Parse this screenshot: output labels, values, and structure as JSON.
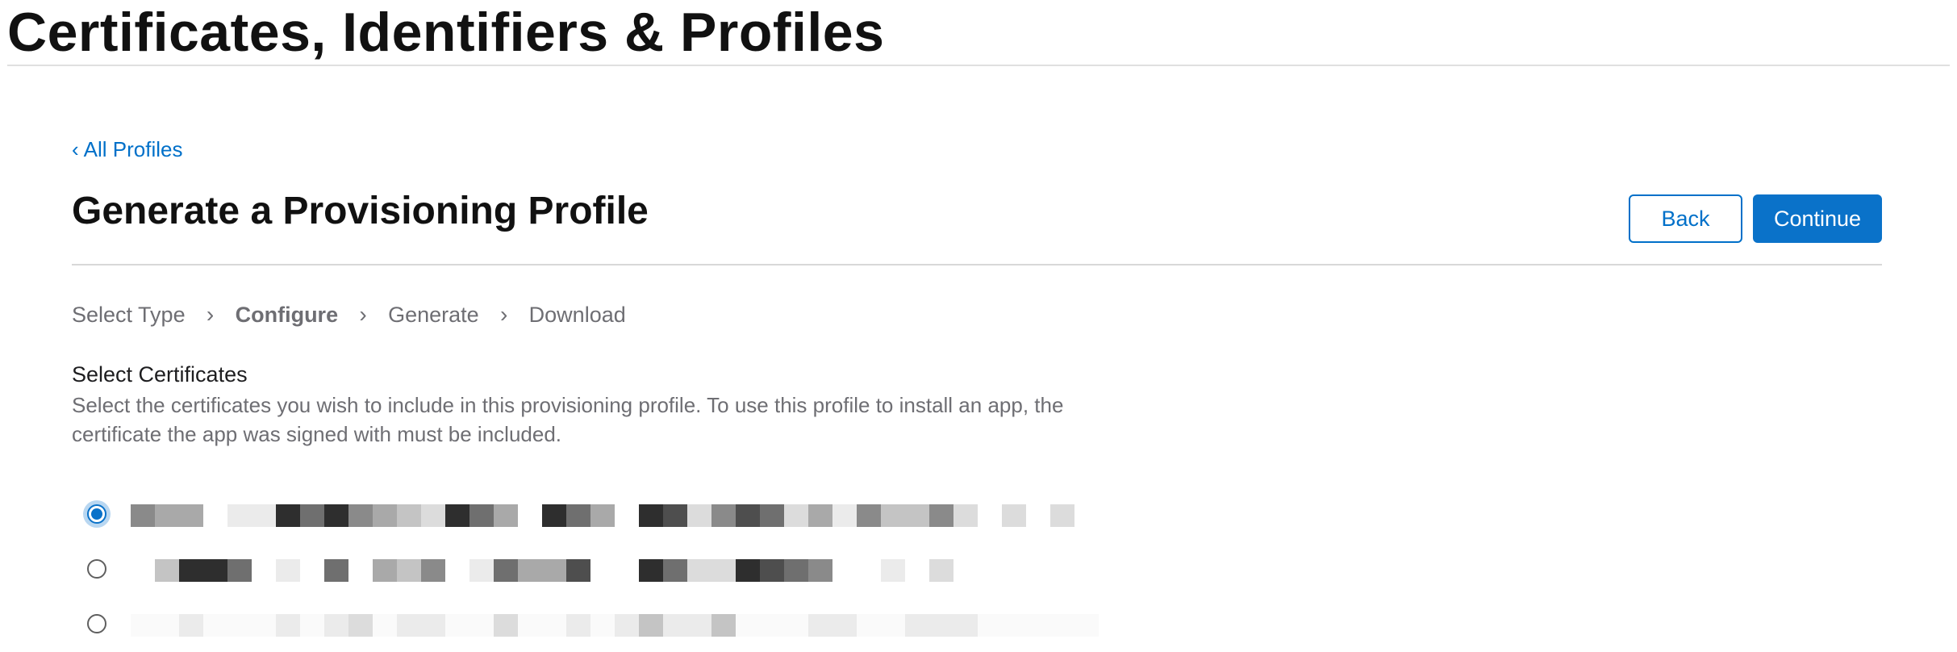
{
  "header": {
    "title": "Certificates, Identifiers & Profiles"
  },
  "breadcrumb": {
    "back_label": "All Profiles"
  },
  "main": {
    "title": "Generate a Provisioning Profile",
    "back_button": "Back",
    "continue_button": "Continue"
  },
  "steps": [
    {
      "label": "Select Type",
      "active": false
    },
    {
      "label": "Configure",
      "active": true
    },
    {
      "label": "Generate",
      "active": false
    },
    {
      "label": "Download",
      "active": false
    }
  ],
  "certificates": {
    "heading": "Select Certificates",
    "description": "Select the certificates you wish to include in this provisioning profile. To use this profile to install an app, the certificate the app was signed with must be included.",
    "items": [
      {
        "selected": true,
        "name_redacted": true
      },
      {
        "selected": false,
        "name_redacted": true
      },
      {
        "selected": false,
        "name_redacted": true
      }
    ]
  },
  "colors": {
    "accent": "#0a72c9",
    "link": "#0070c9",
    "muted_text": "#6e6e73",
    "divider": "#d8d8d8"
  },
  "icons": {
    "back": "chevron-left-icon",
    "step_separator": "chevron-right-icon"
  }
}
